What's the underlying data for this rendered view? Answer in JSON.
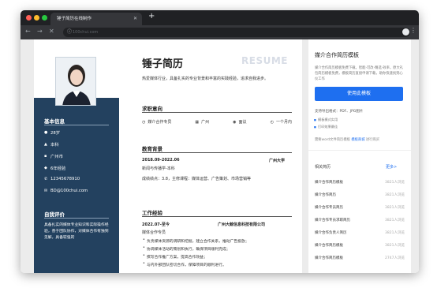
{
  "browser": {
    "tab_title": "锤子简历在线制作",
    "url": "100chui.com"
  },
  "resume": {
    "name": "锤子简历",
    "watermark": "RESUME",
    "intro": "热爱媒体行业，具备扎实的专业背景和丰富的实践经验，追求自我进步。",
    "sidebar": {
      "basic_title": "基本信息",
      "basic_items": [
        {
          "icon": "user-icon",
          "text": "28岁"
        },
        {
          "icon": "education-icon",
          "text": "本科"
        },
        {
          "icon": "location-icon",
          "text": "广州市"
        },
        {
          "icon": "experience-icon",
          "text": "6年经验"
        },
        {
          "icon": "phone-icon",
          "text": "12345678910"
        },
        {
          "icon": "email-icon",
          "text": "BD@100chui.com"
        }
      ],
      "eval_title": "自我评价",
      "eval_text": "具备扎实的媒体专业知识和实际操作经验，善于团队协作，对媒体合作有独到见解，具备较强的"
    },
    "intent": {
      "title": "求职意向",
      "items": [
        {
          "icon": "bag-icon",
          "text": "媒介合作专员"
        },
        {
          "icon": "building-icon",
          "text": "广州"
        },
        {
          "icon": "salary-icon",
          "text": "面议"
        },
        {
          "icon": "clock-icon",
          "text": "一个月内"
        }
      ]
    },
    "education": {
      "title": "教育背景",
      "period": "2018.09-2022.06",
      "school": "广州大学",
      "major": "新闻与传播学-本科",
      "detail": "成绩绩点：3.8，主修课程：媒体运营、广告策划、市场营销等"
    },
    "work": {
      "title": "工作经验",
      "period": "2022.07-至今",
      "company": "广州大鲸信息科技有限公司",
      "role": "媒体合作专员",
      "bullets": [
        "负责媒体资源的调研和挖掘，建立合作关系，推动广告投放；",
        "协调媒体活动的策划和执行，确保项目顺利完成；",
        "撰写合作推广方案，提高合作效益；",
        "与内外部团队密切合作，保障项目的顺利进行。"
      ]
    }
  },
  "panel": {
    "title": "媒介合作简历模板",
    "desc": "媒介合作简历模板免费下载，智能-可改-精选-效率，原大礼包简历模板免费，模板简历直接申请下载，助你快速找到心仪工作",
    "use_button": "使用此模板",
    "support": "支持导出格式：PDF、JPG图片",
    "features": [
      "模板模式实用",
      "打印效果最佳"
    ],
    "help_prefix": "需要word文件简历模板",
    "help_link": "模板商城",
    "help_suffix": "进行购买",
    "rec_title": "相关简历",
    "rec_more": "更多>",
    "rec_items": [
      {
        "name": "媒介合作简历模板",
        "count": "3821人浏览"
      },
      {
        "name": "媒介合作简历",
        "count": "3821人浏览"
      },
      {
        "name": "媒介合作专员简历",
        "count": "3821人浏览"
      },
      {
        "name": "媒介合作专员求职简历",
        "count": "3821人浏览"
      },
      {
        "name": "媒介合作负责人简历",
        "count": "3821人浏览"
      },
      {
        "name": "媒介合作简历模板",
        "count": "3821人浏览"
      },
      {
        "name": "媒介合作简历模板",
        "count": "2747人浏览"
      }
    ]
  },
  "colors": {
    "sidebar_bg": "#23415f",
    "accent": "#1e6ff0"
  }
}
